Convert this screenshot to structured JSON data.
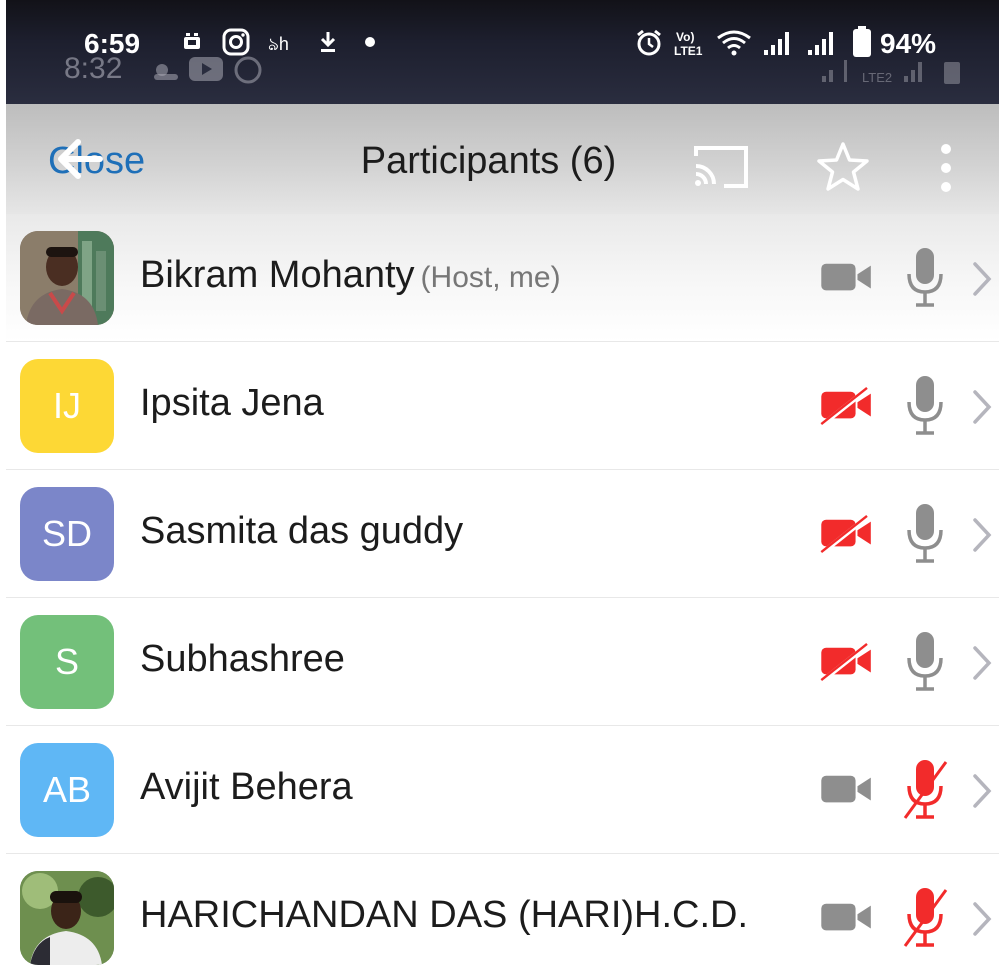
{
  "status_bar": {
    "time": "6:59",
    "ghost_time": "8:32",
    "battery": "94%",
    "icons": [
      "sim-icon",
      "instagram-icon",
      "dh-icon",
      "download-icon",
      "dot-icon",
      "alarm-icon",
      "volte-icon",
      "wifi-icon",
      "signal-icon",
      "signal-icon",
      "battery-icon"
    ]
  },
  "top_bar": {
    "close_label": "Close",
    "title": "Participants (6)",
    "icons": [
      "back-arrow-icon",
      "cast-icon",
      "star-icon",
      "more-vertical-icon"
    ]
  },
  "colors": {
    "accent": "#1e6fb8",
    "muted_red": "#f22b2b",
    "icon_gray": "#8e8e8e"
  },
  "participants": [
    {
      "name": "Bikram Mohanty",
      "role": "(Host, me)",
      "initials": "",
      "avatar_type": "photo",
      "avatar_color": "#6b5a4a",
      "video": "on",
      "audio": "on"
    },
    {
      "name": "Ipsita Jena",
      "role": "",
      "initials": "IJ",
      "avatar_type": "initials",
      "avatar_color": "#fdd835",
      "video": "off",
      "audio": "on"
    },
    {
      "name": "Sasmita das guddy",
      "role": "",
      "initials": "SD",
      "avatar_type": "initials",
      "avatar_color": "#7b86c9",
      "video": "off",
      "audio": "on"
    },
    {
      "name": "Subhashree",
      "role": "",
      "initials": "S",
      "avatar_type": "initials",
      "avatar_color": "#73c07a",
      "video": "off",
      "audio": "on"
    },
    {
      "name": "Avijit Behera",
      "role": "",
      "initials": "AB",
      "avatar_type": "initials",
      "avatar_color": "#5fb7f5",
      "video": "on",
      "audio": "off"
    },
    {
      "name": "HARICHANDAN DAS (HARI)H.C.D.",
      "role": "",
      "initials": "",
      "avatar_type": "photo",
      "avatar_color": "#4d6b3a",
      "video": "on",
      "audio": "off"
    }
  ]
}
